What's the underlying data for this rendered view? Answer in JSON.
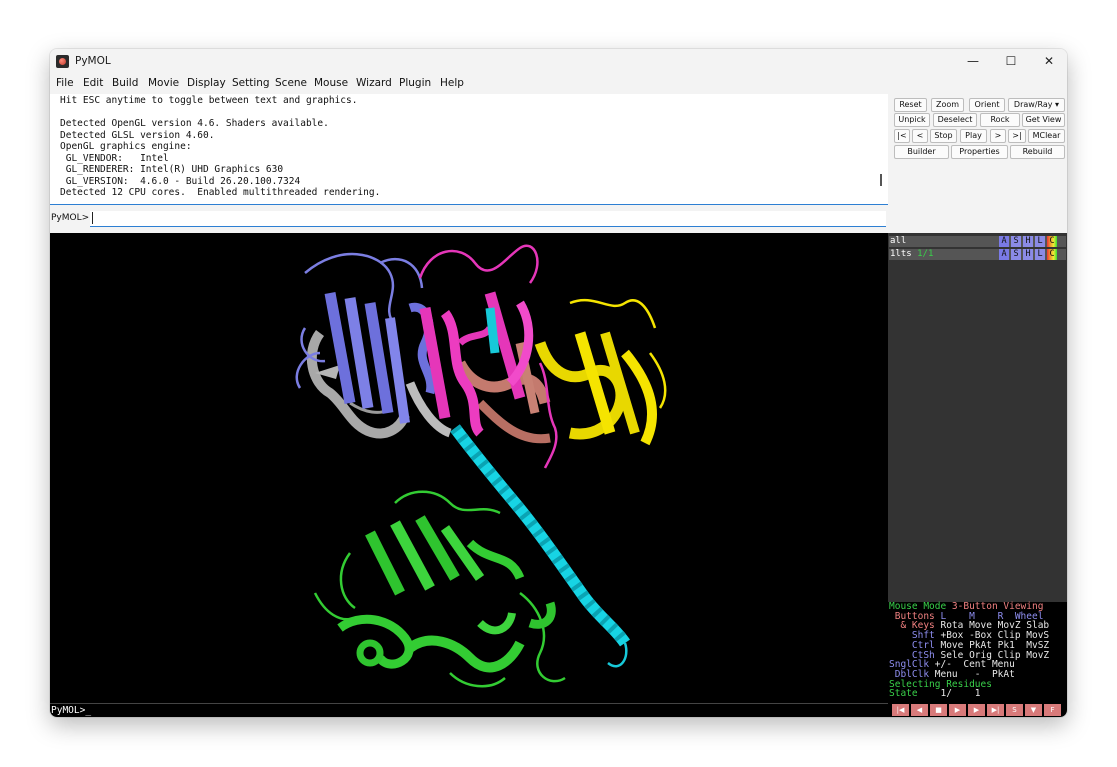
{
  "window": {
    "title": "PyMOL",
    "controls": {
      "minimize": "—",
      "maximize": "☐",
      "close": "✕"
    }
  },
  "menu": [
    "File",
    "Edit",
    "Build",
    "Movie",
    "Display",
    "Setting",
    "Scene",
    "Mouse",
    "Wizard",
    "Plugin",
    "Help"
  ],
  "output": {
    "lines": [
      "Hit ESC anytime to toggle between text and graphics.",
      "",
      "Detected OpenGL version 4.6. Shaders available.",
      "Detected GLSL version 4.60.",
      "OpenGL graphics engine:",
      " GL_VENDOR:   Intel",
      " GL_RENDERER: Intel(R) UHD Graphics 630",
      " GL_VERSION:  4.6.0 - Build 26.20.100.7324",
      "Detected 12 CPU cores.  Enabled multithreaded rendering."
    ]
  },
  "command": {
    "label": "PyMOL>",
    "value": ""
  },
  "buttons": {
    "row1": [
      "Reset",
      "Zoom",
      "Orient",
      "Draw/Ray ▾"
    ],
    "row2": [
      "Unpick",
      "Deselect",
      "Rock",
      "Get View"
    ],
    "row3": [
      "|<",
      "<",
      "Stop",
      "Play",
      ">",
      ">|",
      "MClear"
    ],
    "row4": [
      "Builder",
      "Properties",
      "Rebuild"
    ]
  },
  "objects": [
    {
      "name": "all",
      "sub": ""
    },
    {
      "name": "1lts",
      "sub": "1/1"
    }
  ],
  "ashlc": [
    "A",
    "S",
    "H",
    "L",
    "C"
  ],
  "mouse_panel": {
    "l1a": "Mouse Mode ",
    "l1b": "3-Button Viewing",
    "l2a": " Buttons ",
    "l2b": "L    M    R  Wheel",
    "l3a": "  & Keys ",
    "l3b": "Rota Move MovZ Slab",
    "l4a": "    Shft ",
    "l4b": "+Box -Box Clip MovS",
    "l5a": "    Ctrl ",
    "l5b": "Move PkAt Pk1  MvSZ",
    "l6a": "    CtSh ",
    "l6b": "Sele Orig Clip MovZ",
    "l7a": "SnglClk ",
    "l7b": "+/-  Cent Menu",
    "l8a": " DblClk ",
    "l8b": "Menu   -  PkAt",
    "l9": "Selecting Residues",
    "l10a": "State ",
    "l10b": "   1/    1"
  },
  "status": {
    "text": "PyMOL>_"
  },
  "transport": [
    "|◀",
    "◀",
    "■",
    "▶",
    "▶",
    "▶|",
    "S",
    "▼",
    "F"
  ],
  "colors": {
    "blue_accent": "#2d7fd3",
    "green_mode": "#39d14a",
    "salmon_btn": "#d87a7a"
  }
}
